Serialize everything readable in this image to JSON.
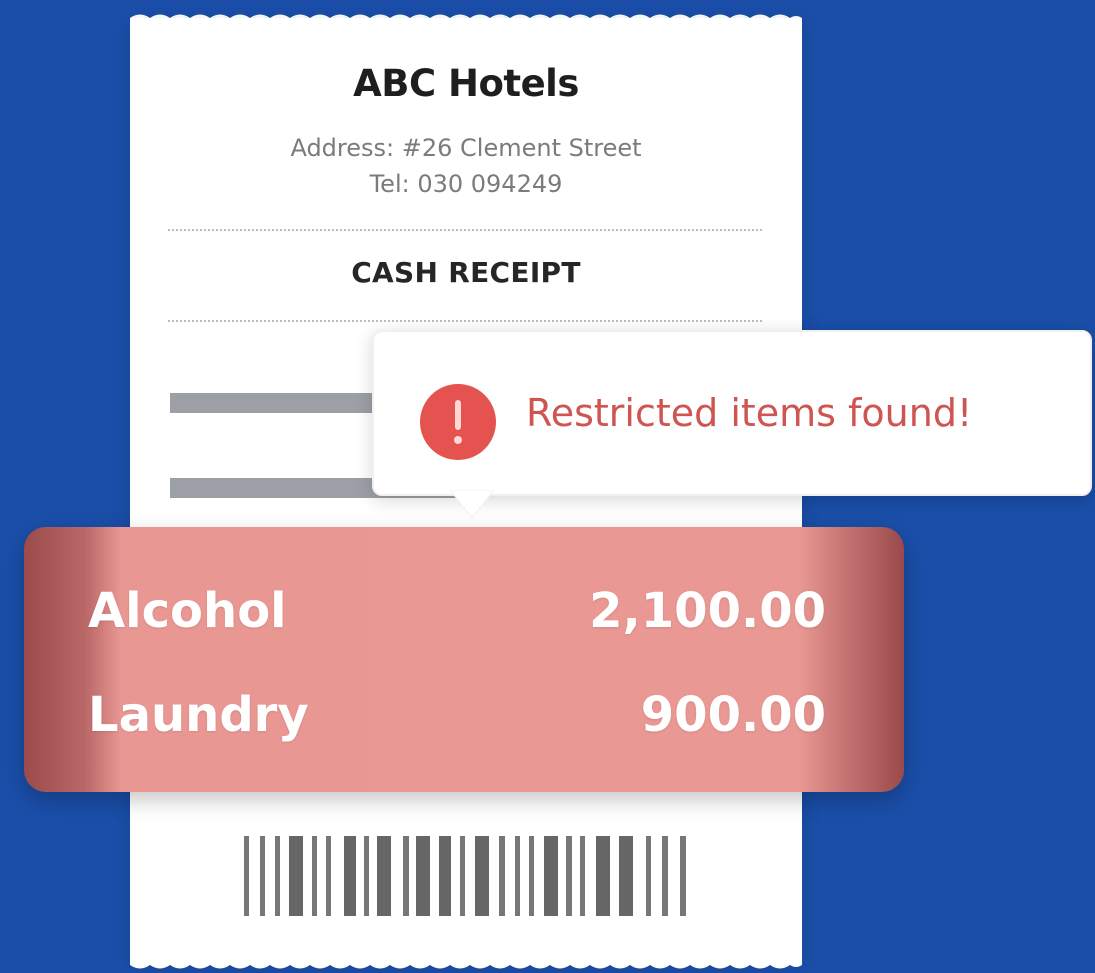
{
  "receipt": {
    "hotel_name": "ABC Hotels",
    "address": "Address: #26 Clement Street",
    "tel": "Tel: 030 094249",
    "title": "CASH RECEIPT"
  },
  "alert": {
    "message": "Restricted items found!",
    "icon_name": "exclamation-icon",
    "icon_color": "#e4534f",
    "text_color": "#cf5552"
  },
  "restricted_items": [
    {
      "name": "Alcohol",
      "amount": "2,100.00"
    },
    {
      "name": "Laundry",
      "amount": "900.00"
    }
  ],
  "colors": {
    "background": "#1a4ea8",
    "receipt": "#ffffff",
    "highlight": "#e99893"
  }
}
